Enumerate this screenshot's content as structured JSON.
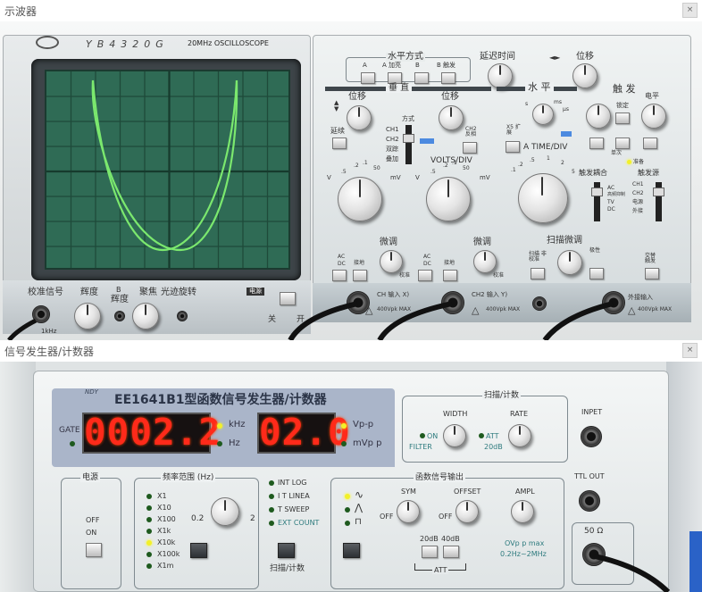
{
  "windows": {
    "scope_title": "示波器",
    "gen_title": "信号发生器/计数器",
    "close_glyph": "×"
  },
  "scope": {
    "brand": "YB4320G",
    "badge": "20MHz  OSCILLOSCOPE",
    "cal_label": "校准信号",
    "cal_freq": "1kHz",
    "brightness": "辉度",
    "b_label": "B",
    "b_brightness": "辉度",
    "focus": "聚焦",
    "trace_rotate": "光迹旋转",
    "power_label": "电源",
    "off": "关",
    "on": "开",
    "horiz_mode": "水平方式",
    "horiz_btns": [
      "A",
      "A 加亮",
      "B",
      "B 触发"
    ],
    "delay_time": "延迟时间",
    "position": "位移",
    "vertical": "垂  直",
    "horizontal": "水  平",
    "trigger": "触  发",
    "ch1_pos": "位移",
    "ch2_pos": "位移",
    "mode_label": "方式",
    "mode_options": [
      "CH1",
      "CH2",
      "双踪",
      "叠加"
    ],
    "invert": "CH2 反相",
    "alt": "延续",
    "x5": "X5 扩展",
    "volts_div": "VOLTS/DIV",
    "fine": "微调",
    "fine2": "微调",
    "ac": "AC",
    "dc": "DC",
    "gnd": "接地",
    "ch1_input": "CH  输入  X)",
    "ch2_input": "CH2 输入  Y)",
    "max_v": "400Vpk MAX",
    "max_v2": "400Vpk MAX",
    "max_v3": "400Vpk MAX",
    "ext_input": "外接输入",
    "time_div": "A TIME/DIV",
    "sweep_fine": "扫描微调",
    "sweep_cal": "扫描 非校准",
    "polarity": "极性",
    "trig_couple": "触发耦合",
    "trig_couple_opts": [
      "AC",
      "高频抑制",
      "TV",
      "DC"
    ],
    "trig_src": "触发源",
    "trig_src_opts": [
      "CH1",
      "CH2",
      "电源",
      "外接"
    ],
    "level": "电平",
    "auto": "锁定",
    "ready": "准备",
    "single": "单次",
    "alt_trig": "交替 触发",
    "v_scale": [
      ".5",
      ".2",
      ".1",
      "50",
      "20",
      "10",
      "5",
      "2",
      "1",
      "2",
      "5"
    ],
    "v_unit_l": "V",
    "v_unit_r": "mV",
    "t_scale": [
      ".1",
      ".2",
      ".5",
      "1",
      "2",
      "5",
      "10",
      "20",
      "50",
      ".1",
      ".2",
      ".5"
    ],
    "t_units": [
      "s",
      "ms",
      "μs"
    ],
    "trace_color": "#7be86e",
    "screen_color": "#2f6b55",
    "knob_label_cal": "校准"
  },
  "gen": {
    "model": "EE1641B1型函数信号发生器/计数器",
    "logo": "NDY",
    "gate": "GATE",
    "freq_value": "0002.2",
    "freq_unit_on": "kHz",
    "freq_unit_off": "Hz",
    "amp_value": "02.0",
    "amp_unit_on": "Vp-p",
    "amp_unit_off": "mVp p",
    "sweep_count": "扫描/计数",
    "width": "WIDTH",
    "rate": "RATE",
    "on_label": "ON",
    "filter": "FILTER",
    "att": "ATT",
    "att_db": "20dB",
    "inpet": "INPET",
    "ttl_out": "TTL OUT",
    "power": "电源",
    "off_label": "OFF",
    "on_label2": "ON",
    "freq_range": "频率范围 (Hz)",
    "ranges": [
      "X1",
      "X10",
      "X100",
      "X1k",
      "X10k",
      "X100k",
      "X1m"
    ],
    "range_active": 4,
    "dial_min": "0.2",
    "dial_max": "2",
    "modes": [
      "INT LOG",
      "I T LINEA",
      "  T SWEEP",
      "EXT COUNT"
    ],
    "sweep_btn_label": "扫描/计数",
    "func_output": "函数信号输出",
    "sym": "SYM",
    "offset": "OFFSET",
    "ampl": "AMPL",
    "off1": "OFF",
    "off2": "OFF",
    "db20": "20dB",
    "db40": "40dB",
    "att2": "ATT",
    "vpp_max": "OVp p max",
    "freq_band": "0.2Hz~2MHz",
    "ohm50": "50 Ω"
  }
}
